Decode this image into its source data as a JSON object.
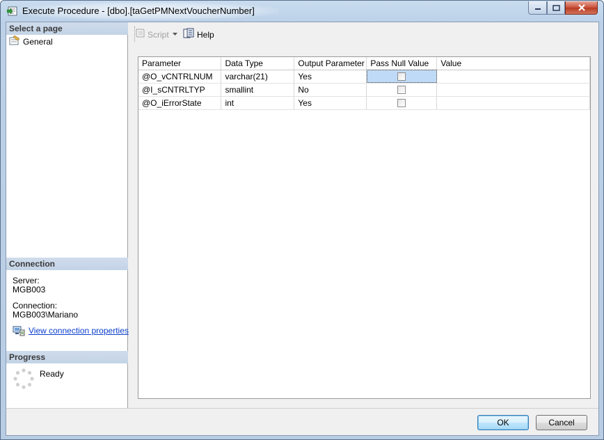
{
  "window": {
    "title": "Execute Procedure - [dbo].[taGetPMNextVoucherNumber]",
    "icon": "execute-procedure-icon"
  },
  "left_pane": {
    "select_page_header": "Select a page",
    "pages": [
      {
        "label": "General",
        "icon": "general-page-icon"
      }
    ],
    "connection_header": "Connection",
    "server_label": "Server:",
    "server_value": "MGB003",
    "connection_label": "Connection:",
    "connection_value": "MGB003\\Mariano",
    "view_connection_link": "View connection properties",
    "progress_header": "Progress",
    "progress_status": "Ready"
  },
  "toolbar": {
    "script_label": "Script",
    "help_label": "Help"
  },
  "grid": {
    "columns": [
      "Parameter",
      "Data Type",
      "Output Parameter",
      "Pass Null Value",
      "Value"
    ],
    "rows": [
      {
        "parameter": "@O_vCNTRLNUM",
        "data_type": "varchar(21)",
        "output": "Yes",
        "pass_null": false,
        "value": ""
      },
      {
        "parameter": "@I_sCNTRLTYP",
        "data_type": "smallint",
        "output": "No",
        "pass_null": false,
        "value": ""
      },
      {
        "parameter": "@O_iErrorState",
        "data_type": "int",
        "output": "Yes",
        "pass_null": false,
        "value": ""
      }
    ]
  },
  "buttons": {
    "ok": "OK",
    "cancel": "Cancel"
  },
  "colors": {
    "selection": "#bfdaf7",
    "section_header": "#c9d8ea",
    "link": "#0b3fcd"
  }
}
